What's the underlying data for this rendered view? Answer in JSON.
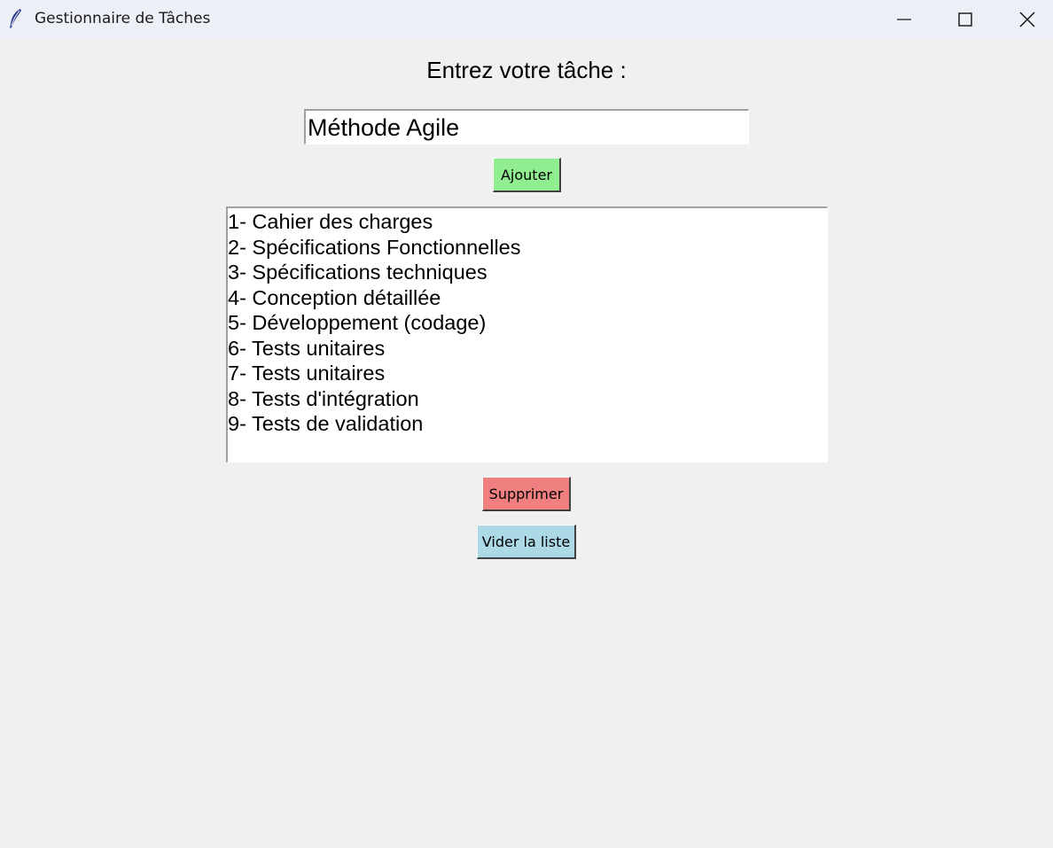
{
  "window": {
    "title": "Gestionnaire de Tâches",
    "icon": "feather-icon",
    "controls": [
      "minimize-icon",
      "maximize-icon",
      "close-icon"
    ]
  },
  "form": {
    "prompt": "Entrez votre tâche :",
    "input_value": "Méthode Agile",
    "add_label": "Ajouter"
  },
  "task_list": {
    "items": [
      "1- Cahier des charges",
      "2- Spécifications Fonctionnelles",
      "3- Spécifications techniques",
      "4- Conception détaillée",
      "5- Développement (codage)",
      "6- Tests unitaires",
      "7- Tests unitaires",
      "8- Tests d'intégration",
      "9- Tests de validation"
    ]
  },
  "actions": {
    "delete_label": "Supprimer",
    "clear_label": "Vider la liste"
  },
  "colors": {
    "add_button": "#90ee90",
    "delete_button": "#f08080",
    "clear_button": "#add8e6",
    "background": "#f0f0f0"
  }
}
